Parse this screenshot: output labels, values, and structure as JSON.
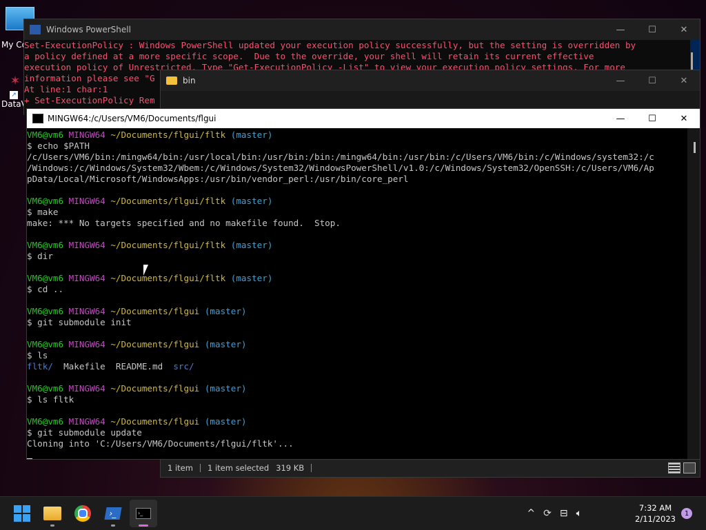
{
  "desktop": {
    "icon1_label": "My Co",
    "icon2_label": "DataV"
  },
  "powershell": {
    "title": "Windows PowerShell",
    "lines": [
      "Set-ExecutionPolicy : Windows PowerShell updated your execution policy successfully, but the setting is overridden by",
      "a policy defined at a more specific scope.  Due to the override, your shell will retain its current effective",
      "execution policy of Unrestricted. Type \"Get-ExecutionPolicy -List\" to view your execution policy settings. For more",
      "information please see \"G",
      "At line:1 char:1",
      "+ Set-ExecutionPolicy Rem"
    ]
  },
  "explorer": {
    "title": "bin",
    "status_count": "1 item",
    "status_selected": "1 item selected",
    "status_size": "319 KB"
  },
  "terminal": {
    "title": "MINGW64:/c/Users/VM6/Documents/flgui",
    "user": "VM6@vm6",
    "env": "MINGW64",
    "path_fltk": "~/Documents/flgui/fltk",
    "path_flgui": "~/Documents/flgui",
    "branch": "(master)",
    "cmd1": "$ echo $PATH",
    "out1a": "/c/Users/VM6/bin:/mingw64/bin:/usr/local/bin:/usr/bin:/bin:/mingw64/bin:/usr/bin:/c/Users/VM6/bin:/c/Windows/system32:/c",
    "out1b": "/Windows:/c/Windows/System32/Wbem:/c/Windows/System32/WindowsPowerShell/v1.0:/c/Windows/System32/OpenSSH:/c/Users/VM6/Ap",
    "out1c": "pData/Local/Microsoft/WindowsApps:/usr/bin/vendor_perl:/usr/bin/core_perl",
    "cmd2": "$ make",
    "out2": "make: *** No targets specified and no makefile found.  Stop.",
    "cmd3": "$ dir",
    "cmd4": "$ cd ..",
    "cmd5": "$ git submodule init",
    "cmd6": "$ ls",
    "ls_fltk": "fltk/",
    "ls_makefile": "  Makefile  README.md  ",
    "ls_src": "src/",
    "cmd7": "$ ls fltk",
    "cmd8": "$ git submodule update",
    "out8": "Cloning into 'C:/Users/VM6/Documents/flgui/fltk'..."
  },
  "taskbar": {
    "time": "7:32 AM",
    "date": "2/11/2023",
    "notifications": "1"
  },
  "colors": {
    "prompt_user": "#24c724",
    "prompt_env": "#c347c3",
    "prompt_path": "#d1b83a",
    "prompt_branch": "#3da0d8",
    "ps_error": "#ff4d6d"
  }
}
